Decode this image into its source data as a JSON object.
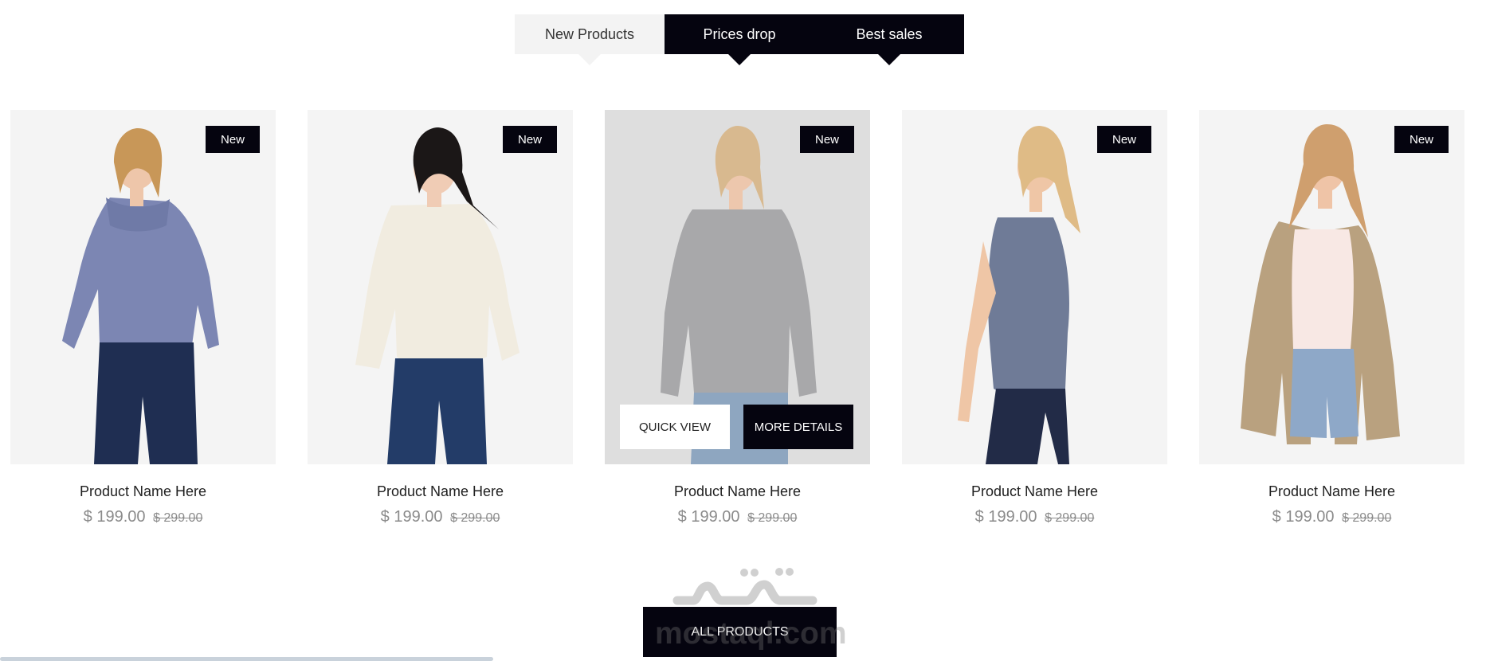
{
  "tabs": [
    {
      "label": "New Products"
    },
    {
      "label": "Prices drop"
    },
    {
      "label": "Best sales"
    }
  ],
  "products": [
    {
      "name": "Product Name Here",
      "price": "$ 199.00",
      "old_price": "$ 299.00",
      "badge": "New"
    },
    {
      "name": "Product Name Here",
      "price": "$ 199.00",
      "old_price": "$ 299.00",
      "badge": "New"
    },
    {
      "name": "Product Name Here",
      "price": "$ 199.00",
      "old_price": "$ 299.00",
      "badge": "New"
    },
    {
      "name": "Product Name Here",
      "price": "$ 199.00",
      "old_price": "$ 299.00",
      "badge": "New"
    },
    {
      "name": "Product Name Here",
      "price": "$ 199.00",
      "old_price": "$ 299.00",
      "badge": "New"
    }
  ],
  "hover_actions": {
    "quick_view": "QUICK VIEW",
    "more_details": "MORE DETAILS"
  },
  "all_products": "ALL PRODUCTS",
  "watermark": {
    "arabic": "مستقل",
    "latin": "mostaql.com"
  },
  "colors": {
    "dark": "#05040f",
    "light_tab": "#f3f3f3",
    "card_bg": "#f4f4f4",
    "price": "#8b8b8b"
  }
}
